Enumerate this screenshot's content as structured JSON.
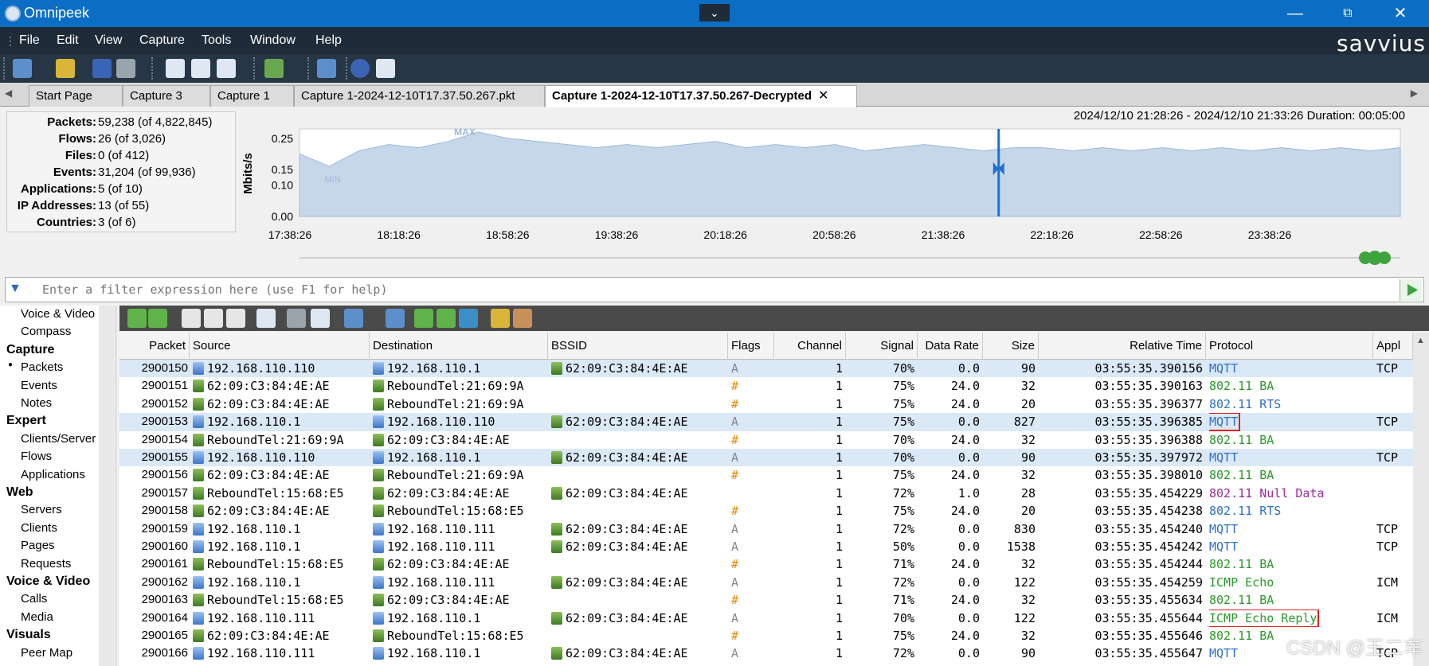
{
  "window": {
    "title": "Omnipeek",
    "minimize": "—",
    "maximize": "⧉",
    "close": "✕",
    "dropdown": "⌄"
  },
  "menu": [
    "File",
    "Edit",
    "View",
    "Capture",
    "Tools",
    "Window",
    "Help"
  ],
  "brand": "savvius",
  "tabs": [
    {
      "label": "Start Page"
    },
    {
      "label": "Capture 3"
    },
    {
      "label": "Capture 1"
    },
    {
      "label": "Capture 1-2024-12-10T17.37.50.267.pkt"
    },
    {
      "label": "Capture 1-2024-12-10T17.37.50.267-Decrypted",
      "active": true,
      "close": "✕"
    }
  ],
  "stats": [
    {
      "k": "Packets:",
      "v": "59,238 (of 4,822,845)"
    },
    {
      "k": "Flows:",
      "v": "26 (of 3,026)"
    },
    {
      "k": "Files:",
      "v": "0 (of 412)"
    },
    {
      "k": "Events:",
      "v": "31,204 (of 99,936)"
    },
    {
      "k": "Applications:",
      "v": "5 (of 10)"
    },
    {
      "k": "IP Addresses:",
      "v": "13 (of 55)"
    },
    {
      "k": "Countries:",
      "v": "3 (of 6)"
    }
  ],
  "duration": "2024/12/10 21:28:26 - 2024/12/10 21:33:26  Duration: 00:05:00",
  "chart_data": {
    "type": "area",
    "ylabel": "Mbits/s",
    "yticks": [
      "0.25",
      "0.15",
      "0.10",
      "0.00"
    ],
    "xticks": [
      "17:38:26",
      "18:18:26",
      "18:58:26",
      "19:38:26",
      "20:18:26",
      "20:58:26",
      "21:38:26",
      "22:18:26",
      "22:58:26",
      "23:38:26"
    ],
    "annotations": [
      "MAX",
      "MIN"
    ],
    "ylim": [
      0,
      0.28
    ],
    "x": [
      "17:38:26",
      "17:48:26",
      "17:58:26",
      "18:08:26",
      "18:18:26",
      "18:28:26",
      "18:38:26",
      "18:48:26",
      "18:58:26",
      "19:08:26",
      "19:18:26",
      "19:28:26",
      "19:38:26",
      "19:48:26",
      "19:58:26",
      "20:08:26",
      "20:18:26",
      "20:28:26",
      "20:38:26",
      "20:48:26",
      "20:58:26",
      "21:08:26",
      "21:18:26",
      "21:28:26",
      "21:38:26",
      "21:48:26",
      "21:58:26",
      "22:08:26",
      "22:18:26",
      "22:28:26",
      "22:38:26",
      "22:48:26",
      "22:58:26",
      "23:08:26",
      "23:18:26",
      "23:28:26",
      "23:38:26",
      "23:48:26"
    ],
    "values": [
      0.2,
      0.16,
      0.21,
      0.23,
      0.22,
      0.24,
      0.27,
      0.25,
      0.24,
      0.23,
      0.22,
      0.23,
      0.22,
      0.23,
      0.24,
      0.22,
      0.23,
      0.22,
      0.23,
      0.21,
      0.22,
      0.23,
      0.22,
      0.21,
      0.22,
      0.22,
      0.21,
      0.22,
      0.21,
      0.22,
      0.21,
      0.22,
      0.21,
      0.22,
      0.21,
      0.22,
      0.21,
      0.22
    ],
    "marker_x": "21:33:26"
  },
  "filter": {
    "placeholder": "Enter a filter expression here (use F1 for help)"
  },
  "nav": [
    {
      "t": "item",
      "label": "Voice & Video"
    },
    {
      "t": "item",
      "label": "Compass"
    },
    {
      "t": "head",
      "label": "Capture"
    },
    {
      "t": "item",
      "label": "Packets",
      "selected": true
    },
    {
      "t": "item",
      "label": "Events"
    },
    {
      "t": "item",
      "label": "Notes"
    },
    {
      "t": "head",
      "label": "Expert"
    },
    {
      "t": "item",
      "label": "Clients/Server"
    },
    {
      "t": "item",
      "label": "Flows"
    },
    {
      "t": "item",
      "label": "Applications"
    },
    {
      "t": "head",
      "label": "Web"
    },
    {
      "t": "item",
      "label": "Servers"
    },
    {
      "t": "item",
      "label": "Clients"
    },
    {
      "t": "item",
      "label": "Pages"
    },
    {
      "t": "item",
      "label": "Requests"
    },
    {
      "t": "head",
      "label": "Voice & Video"
    },
    {
      "t": "item",
      "label": "Calls"
    },
    {
      "t": "item",
      "label": "Media"
    },
    {
      "t": "head",
      "label": "Visuals"
    },
    {
      "t": "item",
      "label": "Peer Map"
    }
  ],
  "columns": [
    "Packet",
    "Source",
    "Destination",
    "BSSID",
    "Flags",
    "Channel",
    "Signal",
    "Data Rate",
    "Size",
    "Relative Time",
    "Protocol",
    "Appl"
  ],
  "protocol_colors": {
    "MQTT": "#2f6fc7",
    "802.11 BA": "#2a9a2a",
    "802.11 RTS": "#2f6fc7",
    "802.11 Null Data": "#9a2a9a",
    "ICMP Echo": "#2a9a2a",
    "ICMP Echo Reply": "#2a9a2a"
  },
  "rows": [
    {
      "packet": "2900150",
      "src": "192.168.110.110",
      "src_icon": "host-icon",
      "dst": "192.168.110.1",
      "dst_icon": "host-icon",
      "bssid": "62:09:C3:84:4E:AE",
      "flags": "A",
      "channel": "1",
      "signal": "70%",
      "rate": "0.0",
      "size": "90",
      "time": "03:55:35.390156",
      "protocol": "MQTT",
      "appl": "TCP",
      "hl": true
    },
    {
      "packet": "2900151",
      "src": "62:09:C3:84:4E:AE",
      "src_icon": "ap-icon",
      "dst": "ReboundTel:21:69:9A",
      "dst_icon": "ap-icon",
      "bssid": "",
      "flags": "#",
      "channel": "1",
      "signal": "75%",
      "rate": "24.0",
      "size": "32",
      "time": "03:55:35.390163",
      "protocol": "802.11 BA",
      "appl": ""
    },
    {
      "packet": "2900152",
      "src": "62:09:C3:84:4E:AE",
      "src_icon": "ap-icon",
      "dst": "ReboundTel:21:69:9A",
      "dst_icon": "ap-icon",
      "bssid": "",
      "flags": "#",
      "channel": "1",
      "signal": "75%",
      "rate": "24.0",
      "size": "20",
      "time": "03:55:35.396377",
      "protocol": "802.11 RTS",
      "appl": ""
    },
    {
      "packet": "2900153",
      "src": "192.168.110.1",
      "src_icon": "host-icon",
      "dst": "192.168.110.110",
      "dst_icon": "host-icon",
      "bssid": "62:09:C3:84:4E:AE",
      "flags": "A",
      "channel": "1",
      "signal": "75%",
      "rate": "0.0",
      "size": "827",
      "time": "03:55:35.396385",
      "protocol": "MQTT",
      "appl": "TCP",
      "hl": true,
      "boxed": true
    },
    {
      "packet": "2900154",
      "src": "ReboundTel:21:69:9A",
      "src_icon": "ap-icon",
      "dst": "62:09:C3:84:4E:AE",
      "dst_icon": "ap-icon",
      "bssid": "",
      "flags": "#",
      "channel": "1",
      "signal": "70%",
      "rate": "24.0",
      "size": "32",
      "time": "03:55:35.396388",
      "protocol": "802.11 BA",
      "appl": ""
    },
    {
      "packet": "2900155",
      "src": "192.168.110.110",
      "src_icon": "host-icon",
      "dst": "192.168.110.1",
      "dst_icon": "host-icon",
      "bssid": "62:09:C3:84:4E:AE",
      "flags": "A",
      "channel": "1",
      "signal": "70%",
      "rate": "0.0",
      "size": "90",
      "time": "03:55:35.397972",
      "protocol": "MQTT",
      "appl": "TCP",
      "hl": true
    },
    {
      "packet": "2900156",
      "src": "62:09:C3:84:4E:AE",
      "src_icon": "ap-icon",
      "dst": "ReboundTel:21:69:9A",
      "dst_icon": "ap-icon",
      "bssid": "",
      "flags": "#",
      "channel": "1",
      "signal": "75%",
      "rate": "24.0",
      "size": "32",
      "time": "03:55:35.398010",
      "protocol": "802.11 BA",
      "appl": ""
    },
    {
      "packet": "2900157",
      "src": "ReboundTel:15:68:E5",
      "src_icon": "ap-icon",
      "dst": "62:09:C3:84:4E:AE",
      "dst_icon": "ap-icon",
      "bssid": "62:09:C3:84:4E:AE",
      "flags": "",
      "channel": "1",
      "signal": "72%",
      "rate": "1.0",
      "size": "28",
      "time": "03:55:35.454229",
      "protocol": "802.11 Null Data",
      "appl": ""
    },
    {
      "packet": "2900158",
      "src": "62:09:C3:84:4E:AE",
      "src_icon": "ap-icon",
      "dst": "ReboundTel:15:68:E5",
      "dst_icon": "ap-icon",
      "bssid": "",
      "flags": "#",
      "channel": "1",
      "signal": "75%",
      "rate": "24.0",
      "size": "20",
      "time": "03:55:35.454238",
      "protocol": "802.11 RTS",
      "appl": ""
    },
    {
      "packet": "2900159",
      "src": "192.168.110.1",
      "src_icon": "host-icon",
      "dst": "192.168.110.111",
      "dst_icon": "host-icon",
      "bssid": "62:09:C3:84:4E:AE",
      "flags": "A",
      "channel": "1",
      "signal": "72%",
      "rate": "0.0",
      "size": "830",
      "time": "03:55:35.454240",
      "protocol": "MQTT",
      "appl": "TCP"
    },
    {
      "packet": "2900160",
      "src": "192.168.110.1",
      "src_icon": "host-icon",
      "dst": "192.168.110.111",
      "dst_icon": "host-icon",
      "bssid": "62:09:C3:84:4E:AE",
      "flags": "A",
      "channel": "1",
      "signal": "50%",
      "rate": "0.0",
      "size": "1538",
      "time": "03:55:35.454242",
      "protocol": "MQTT",
      "appl": "TCP"
    },
    {
      "packet": "2900161",
      "src": "ReboundTel:15:68:E5",
      "src_icon": "ap-icon",
      "dst": "62:09:C3:84:4E:AE",
      "dst_icon": "ap-icon",
      "bssid": "",
      "flags": "#",
      "channel": "1",
      "signal": "71%",
      "rate": "24.0",
      "size": "32",
      "time": "03:55:35.454244",
      "protocol": "802.11 BA",
      "appl": ""
    },
    {
      "packet": "2900162",
      "src": "192.168.110.1",
      "src_icon": "host-icon",
      "dst": "192.168.110.111",
      "dst_icon": "host-icon",
      "bssid": "62:09:C3:84:4E:AE",
      "flags": "A",
      "channel": "1",
      "signal": "72%",
      "rate": "0.0",
      "size": "122",
      "time": "03:55:35.454259",
      "protocol": "ICMP Echo",
      "appl": "ICM"
    },
    {
      "packet": "2900163",
      "src": "ReboundTel:15:68:E5",
      "src_icon": "ap-icon",
      "dst": "62:09:C3:84:4E:AE",
      "dst_icon": "ap-icon",
      "bssid": "",
      "flags": "#",
      "channel": "1",
      "signal": "71%",
      "rate": "24.0",
      "size": "32",
      "time": "03:55:35.455634",
      "protocol": "802.11 BA",
      "appl": ""
    },
    {
      "packet": "2900164",
      "src": "192.168.110.111",
      "src_icon": "host-icon",
      "dst": "192.168.110.1",
      "dst_icon": "host-icon",
      "bssid": "62:09:C3:84:4E:AE",
      "flags": "A",
      "channel": "1",
      "signal": "70%",
      "rate": "0.0",
      "size": "122",
      "time": "03:55:35.455644",
      "protocol": "ICMP Echo Reply",
      "appl": "ICM",
      "boxed": true
    },
    {
      "packet": "2900165",
      "src": "62:09:C3:84:4E:AE",
      "src_icon": "ap-icon",
      "dst": "ReboundTel:15:68:E5",
      "dst_icon": "ap-icon",
      "bssid": "",
      "flags": "#",
      "channel": "1",
      "signal": "75%",
      "rate": "24.0",
      "size": "32",
      "time": "03:55:35.455646",
      "protocol": "802.11 BA",
      "appl": ""
    },
    {
      "packet": "2900166",
      "src": "192.168.110.111",
      "src_icon": "host-icon",
      "dst": "192.168.110.1",
      "dst_icon": "host-icon",
      "bssid": "62:09:C3:84:4E:AE",
      "flags": "A",
      "channel": "1",
      "signal": "72%",
      "rate": "0.0",
      "size": "90",
      "time": "03:55:35.455647",
      "protocol": "MQTT",
      "appl": "TCP"
    }
  ],
  "watermark": "CSDN @王二车"
}
